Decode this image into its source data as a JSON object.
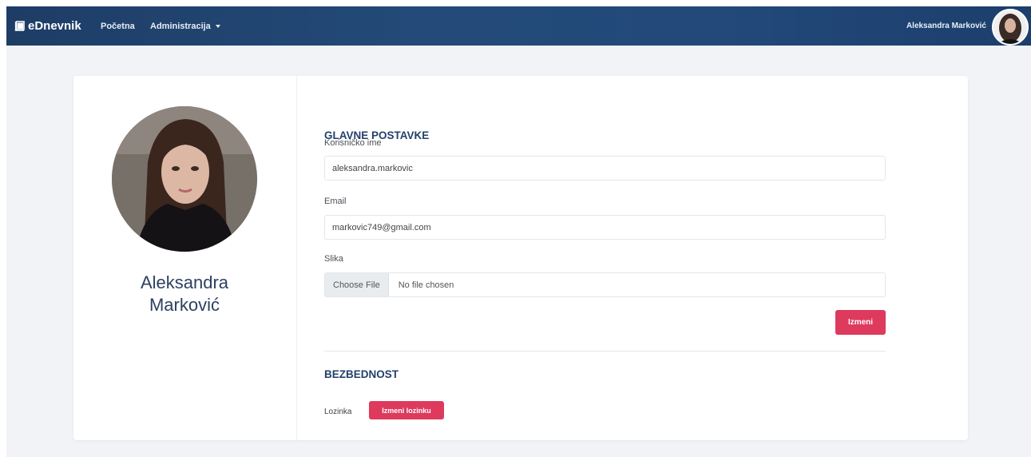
{
  "navbar": {
    "brand": "eDnevnik",
    "links": [
      "Početna",
      "Administracija"
    ],
    "user_name": "Aleksandra Marković"
  },
  "profile": {
    "name": "Aleksandra Marković"
  },
  "settings": {
    "main_title": "GLAVNE POSTAVKE",
    "username_label": "Korisničko ime",
    "username_value": "aleksandra.markovic",
    "email_label": "Email",
    "email_value": "markovic749@gmail.com",
    "image_label": "Slika",
    "choose_file": "Choose File",
    "no_file": "No file chosen",
    "submit": "Izmeni"
  },
  "security": {
    "title": "BEZBEDNOST",
    "password_label": "Lozinka",
    "change_password": "Izmeni lozinku"
  },
  "colors": {
    "navbar": "#234a78",
    "accent": "#dd3a5d",
    "heading": "#24406a"
  },
  "icons": {
    "brand": "book-icon",
    "dropdown": "caret-down-icon"
  }
}
